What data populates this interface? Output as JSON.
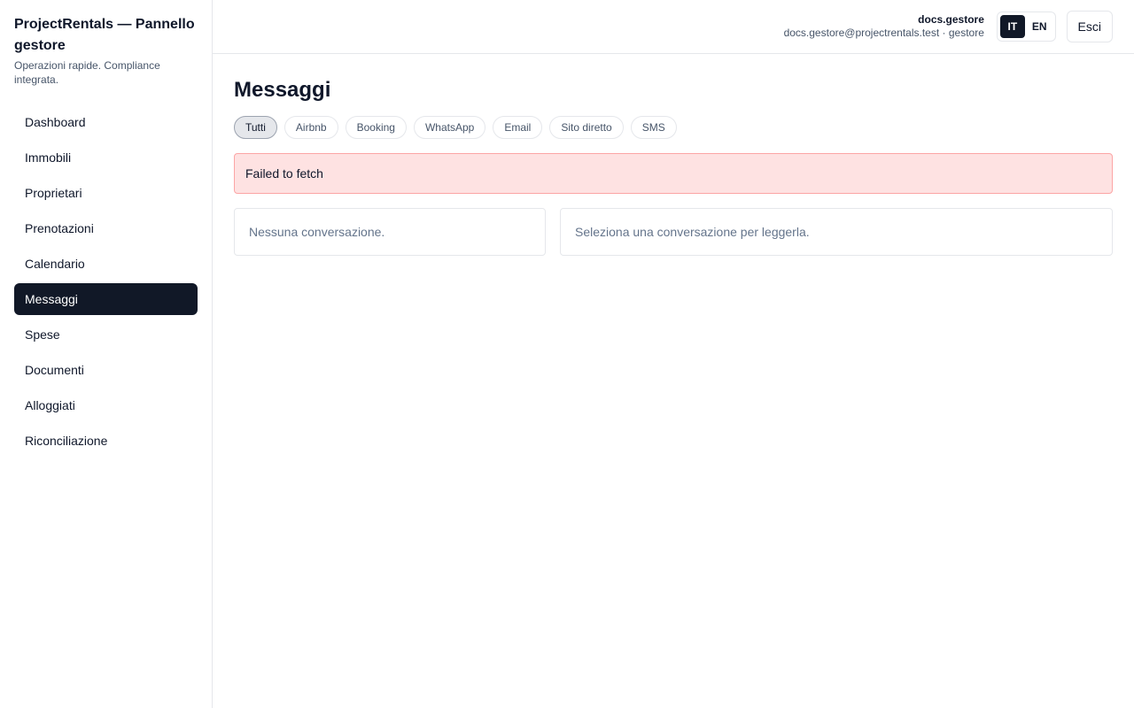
{
  "brand": {
    "title": "ProjectRentals — Pannello gestore",
    "subtitle": "Operazioni rapide. Compliance integrata."
  },
  "nav": {
    "items": [
      {
        "label": "Dashboard",
        "active": false
      },
      {
        "label": "Immobili",
        "active": false
      },
      {
        "label": "Proprietari",
        "active": false
      },
      {
        "label": "Prenotazioni",
        "active": false
      },
      {
        "label": "Calendario",
        "active": false
      },
      {
        "label": "Messaggi",
        "active": true
      },
      {
        "label": "Spese",
        "active": false
      },
      {
        "label": "Documenti",
        "active": false
      },
      {
        "label": "Alloggiati",
        "active": false
      },
      {
        "label": "Riconciliazione",
        "active": false
      }
    ]
  },
  "user": {
    "name": "docs.gestore",
    "details": "docs.gestore@projectrentals.test · gestore"
  },
  "language": {
    "options": [
      "IT",
      "EN"
    ],
    "selected": "IT"
  },
  "logout_label": "Esci",
  "page": {
    "title": "Messaggi"
  },
  "filters": {
    "items": [
      "Tutti",
      "Airbnb",
      "Booking",
      "WhatsApp",
      "Email",
      "Sito diretto",
      "SMS"
    ],
    "selected": "Tutti"
  },
  "error": {
    "message": "Failed to fetch"
  },
  "conversations": {
    "empty_text": "Nessuna conversazione."
  },
  "detail": {
    "empty_text": "Seleziona una conversazione per leggerla."
  },
  "colors": {
    "accent": "#111827",
    "error_bg": "#fee2e2",
    "error_border": "#fca5a5"
  }
}
